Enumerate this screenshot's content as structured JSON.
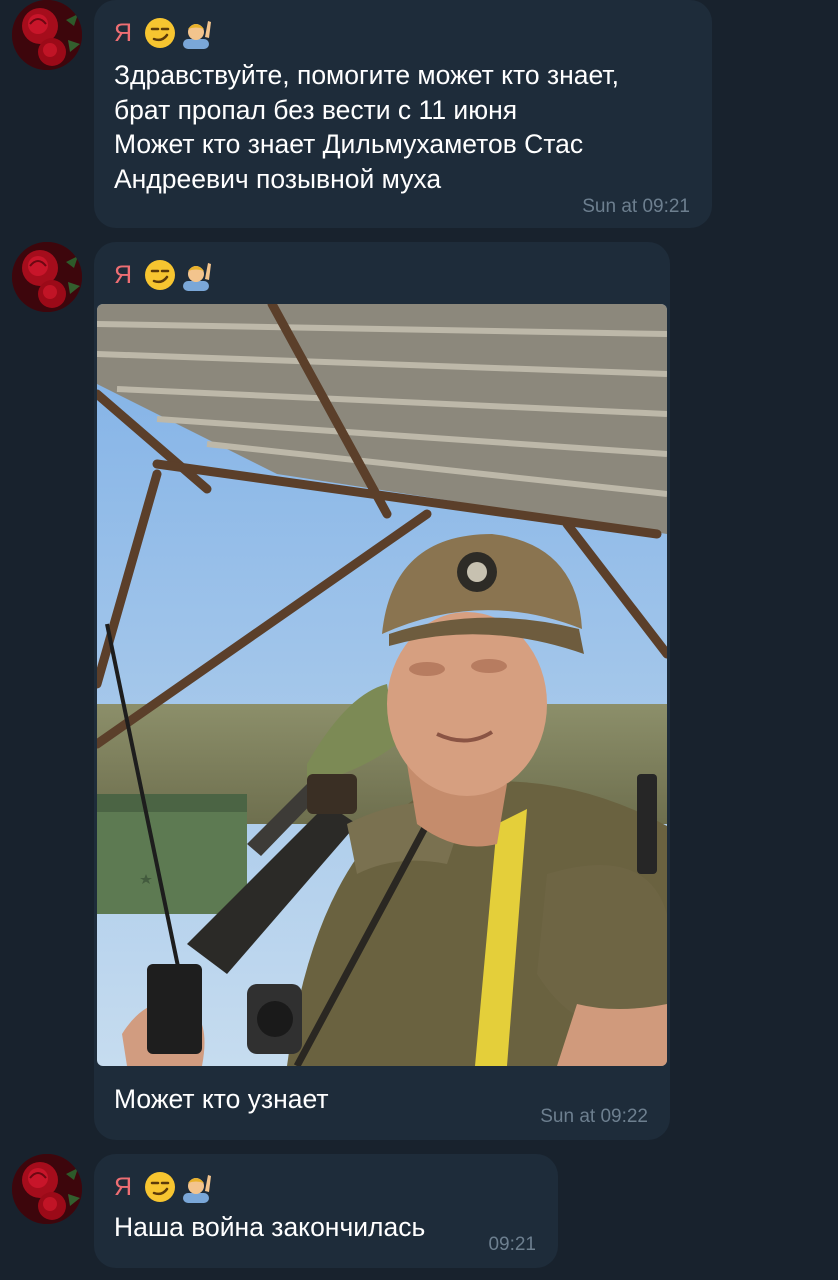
{
  "messages": [
    {
      "sender": "Я",
      "text": "Здравствуйте, помогите может кто знает,\nбрат пропал без вести с 11 июня\nМожет кто знает Дильмухаметов Стас\nАндреевич позывной муха",
      "time": "Sun at 09:21"
    },
    {
      "sender": "Я",
      "caption": "Может кто узнает",
      "time": "Sun at 09:22",
      "photo_icon": "soldier-selfie-photo"
    },
    {
      "sender": "Я",
      "text": "Наша война закончилась",
      "time": "09:21"
    }
  ],
  "sender_emojis": [
    "smirking-face-icon",
    "person-raising-hand-icon"
  ],
  "colors": {
    "background": "#18222d",
    "bubble": "#1e2c3a",
    "sender_name": "#ee6e73",
    "time": "#6d7f8f",
    "text": "#ffffff"
  }
}
